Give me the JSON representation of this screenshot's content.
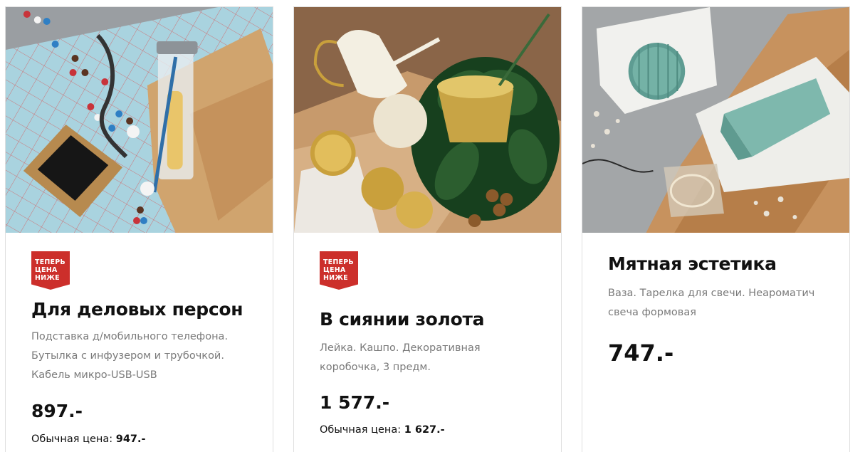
{
  "colors": {
    "badge_red": "#cc2f2b",
    "border": "#dfdfdf",
    "muted_text": "#7a7a7a"
  },
  "cards": [
    {
      "image_alt": "Подставка для телефона, бутылка с инфузером и кабель",
      "badge": [
        "ТЕПЕРЬ",
        "ЦЕНА",
        "НИЖЕ"
      ],
      "title": "Для деловых персон",
      "description_lines": [
        "Подставка д/мобильного телефона.",
        "Бутылка с инфузером и трубочкой.",
        "Кабель микро-USB-USB"
      ],
      "price": "897.-",
      "regular_label": "Обычная цена:",
      "regular_price": "947.-"
    },
    {
      "image_alt": "Лейка, кашпо и декоративная коробочка золотого цвета",
      "badge": [
        "ТЕПЕРЬ",
        "ЦЕНА",
        "НИЖЕ"
      ],
      "title": "В сиянии золота",
      "description_lines": [
        "Лейка. Кашпо. Декоративная",
        "коробочка, 3 предм."
      ],
      "price": "1 577.-",
      "regular_label": "Обычная цена:",
      "regular_price": "1 627.-"
    },
    {
      "image_alt": "Мятная ваза, тарелка для свечи и свеча формовая",
      "title": "Мятная эстетика",
      "description_lines": [
        "Ваза. Тарелка для свечи. Неароматич",
        "свеча формовая"
      ],
      "price": "747.-"
    }
  ]
}
